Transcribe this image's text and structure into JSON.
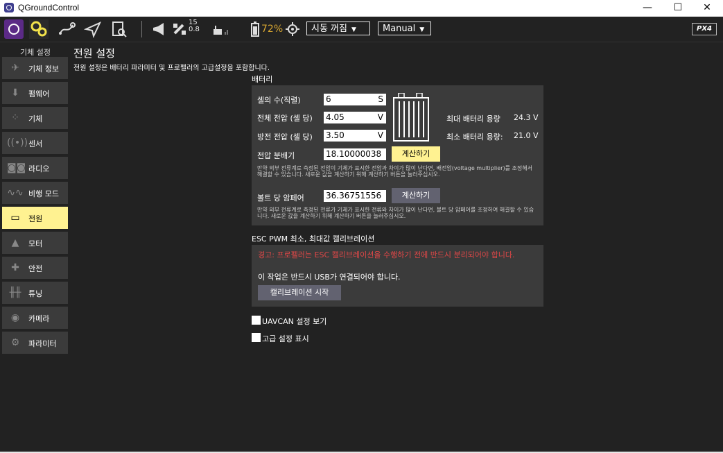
{
  "window": {
    "title": "QGroundControl",
    "controls": {
      "minimize": "—",
      "maximize": "☐",
      "close": "✕"
    }
  },
  "toolbar": {
    "satellites": "15",
    "hdop": "0.8",
    "battery": "72%",
    "flight_status": "시동 꺼짐",
    "flight_mode": "Manual",
    "brand": "PX4"
  },
  "sidebar": {
    "title": "기체 설정",
    "items": [
      {
        "label": "기체 정보",
        "icon": "plane-icon"
      },
      {
        "label": "펌웨어",
        "icon": "firmware-icon"
      },
      {
        "label": "기체",
        "icon": "airframe-icon"
      },
      {
        "label": "센서",
        "icon": "sensor-icon"
      },
      {
        "label": "라디오",
        "icon": "radio-icon"
      },
      {
        "label": "비행 모드",
        "icon": "flight-modes-icon"
      },
      {
        "label": "전원",
        "icon": "power-icon"
      },
      {
        "label": "모터",
        "icon": "motor-icon"
      },
      {
        "label": "안전",
        "icon": "safety-icon"
      },
      {
        "label": "튜닝",
        "icon": "tuning-icon"
      },
      {
        "label": "카메라",
        "icon": "camera-icon"
      },
      {
        "label": "파라미터",
        "icon": "parameters-icon"
      }
    ],
    "active_index": 6
  },
  "main": {
    "title": "전원 설정",
    "description": "전원 설정은 배터리 파라미터 및 프로펠러의 고급설정을 포함합니다.",
    "battery": {
      "section_title": "배터리",
      "cells_label": "셀의 수(직렬)",
      "cells_value": "6",
      "cells_unit": "S",
      "full_voltage_label": "전체 전압 (셀 당)",
      "full_voltage_value": "4.05",
      "full_voltage_unit": "V",
      "empty_voltage_label": "방전 전압 (셀 당)",
      "empty_voltage_value": "3.50",
      "empty_voltage_unit": "V",
      "max_capacity_label": "최대 배터리 용량",
      "max_capacity_value": "24.3 V",
      "min_capacity_label": "최소 배터리 용량:",
      "min_capacity_value": "21.0 V",
      "divider_label": "전압 분배기",
      "divider_value": "18.10000038",
      "divider_calc": "계산하기",
      "divider_note": "만약 외부 전류계로 측정된 전압이 기체가 표시한 전압과 차이가 많이 난다면, 배전압(voltage multiplier)를 조정해서 해결할 수 있습니다. 새로운 값을 계산하기 위해 계산하기 버튼을 눌러주십시오.",
      "amps_label": "볼트 당 암페어",
      "amps_value": "36.36751556",
      "amps_calc": "계산하기",
      "amps_note": "만약 외부 전류계로 측정된 전류가 기체가 표시한 전류와 차이가 많이 난다면, 볼트 당 암페어를 조정하여 해결할 수 있습니다. 새로운 값을 계산하기 위해 계산하기 버튼을 눌러주십시오."
    },
    "esc": {
      "section_title": "ESC PWM 최소, 최대값 캘리브레이션",
      "warning": "경고: 프로펠러는 ESC 캘리브레이션을 수행하기 전에 반드시 분리되어야 합니다.",
      "usb_note": "이 작업은 반드시 USB가 연결되어야 합니다.",
      "start_button": "캘리브레이션 시작"
    },
    "options": {
      "uavcan": "UAVCAN 설정 보기",
      "advanced": "고급 설정 표시"
    }
  },
  "colors": {
    "accent": "#fff291",
    "warning": "#e04747",
    "battery_status": "#d7a630",
    "panel": "#3b3b3b",
    "background": "#222222"
  }
}
